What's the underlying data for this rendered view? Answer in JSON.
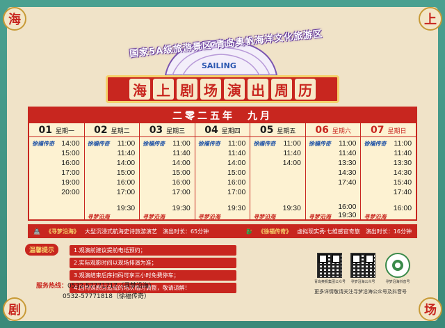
{
  "corners": [
    "海",
    "上",
    "剧",
    "场"
  ],
  "header": {
    "subtitle": "国家5A级旅游景区·青岛奥帆海洋文化旅游区",
    "building_sign": "SAILING",
    "title_chars": [
      "海",
      "上",
      "剧",
      "场",
      "演",
      "出",
      "周",
      "历"
    ]
  },
  "schedule": {
    "month": "二零二五年　九月",
    "days": [
      {
        "num": "01",
        "week": "星期一",
        "weekend": false,
        "slots": [
          {
            "row": 0,
            "logo": "",
            "time": "14:00"
          },
          {
            "row": 1,
            "logo": "",
            "time": "15:00"
          },
          {
            "row": 2,
            "logo": "",
            "time": "16:00"
          },
          {
            "row": 3,
            "logo": "",
            "time": "17:00"
          },
          {
            "row": 4,
            "logo": "",
            "time": "19:00"
          },
          {
            "row": 5,
            "logo": "",
            "time": "20:00"
          }
        ],
        "logo_rows": [
          {
            "row": 0,
            "text": "徐福传奇",
            "red": false
          }
        ]
      },
      {
        "num": "02",
        "week": "星期二",
        "weekend": false,
        "slots": [
          {
            "row": 0,
            "time": "11:00"
          },
          {
            "row": 1,
            "time": "11:40"
          },
          {
            "row": 2,
            "time": "14:00"
          },
          {
            "row": 3,
            "time": "15:00"
          },
          {
            "row": 4,
            "time": "16:00"
          },
          {
            "row": 5,
            "time": "17:00"
          },
          {
            "row": 7,
            "time": "19:30"
          }
        ],
        "logo_rows": [
          {
            "row": 0,
            "text": "徐福传奇",
            "red": false
          },
          {
            "row": 7,
            "text": "寻梦沿海",
            "red": true
          }
        ]
      },
      {
        "num": "03",
        "week": "星期三",
        "weekend": false,
        "slots": [
          {
            "row": 0,
            "time": "11:00"
          },
          {
            "row": 1,
            "time": "11:40"
          },
          {
            "row": 2,
            "time": "14:00"
          },
          {
            "row": 3,
            "time": "15:00"
          },
          {
            "row": 4,
            "time": "16:00"
          },
          {
            "row": 5,
            "time": "17:00"
          },
          {
            "row": 7,
            "time": "19:30"
          }
        ],
        "logo_rows": [
          {
            "row": 0,
            "text": "徐福传奇",
            "red": false
          },
          {
            "row": 7,
            "text": "寻梦沿海",
            "red": true
          }
        ]
      },
      {
        "num": "04",
        "week": "星期四",
        "weekend": false,
        "slots": [
          {
            "row": 0,
            "time": "11:00"
          },
          {
            "row": 1,
            "time": "11:40"
          },
          {
            "row": 2,
            "time": "14:00"
          },
          {
            "row": 3,
            "time": "15:00"
          },
          {
            "row": 4,
            "time": "16:00"
          },
          {
            "row": 5,
            "time": "17:00"
          },
          {
            "row": 7,
            "time": "19:30"
          }
        ],
        "logo_rows": [
          {
            "row": 0,
            "text": "徐福传奇",
            "red": false
          },
          {
            "row": 7,
            "text": "寻梦沿海",
            "red": true
          }
        ]
      },
      {
        "num": "05",
        "week": "星期五",
        "weekend": false,
        "slots": [
          {
            "row": 0,
            "time": "11:00"
          },
          {
            "row": 1,
            "time": "11:40"
          },
          {
            "row": 2,
            "time": "14:00"
          },
          {
            "row": 7,
            "time": "19:30"
          }
        ],
        "logo_rows": [
          {
            "row": 0,
            "text": "徐福传奇",
            "red": false
          },
          {
            "row": 7,
            "text": "寻梦沿海",
            "red": true
          }
        ]
      },
      {
        "num": "06",
        "week": "星期六",
        "weekend": true,
        "slots": [
          {
            "row": 0,
            "time": "11:00"
          },
          {
            "row": 1,
            "time": "11:40"
          },
          {
            "row": 2,
            "time": "13:30"
          },
          {
            "row": 3,
            "time": "14:30"
          },
          {
            "row": 4,
            "time": "17:40"
          },
          {
            "row": 7,
            "time": "16:00"
          },
          {
            "row": 8,
            "time": "19:30"
          }
        ],
        "logo_rows": [
          {
            "row": 0,
            "text": "徐福传奇",
            "red": false
          },
          {
            "row": 7,
            "text": "寻梦沿海",
            "red": true
          }
        ]
      },
      {
        "num": "07",
        "week": "星期日",
        "weekend": true,
        "slots": [
          {
            "row": 0,
            "time": "11:00"
          },
          {
            "row": 1,
            "time": "11:40"
          },
          {
            "row": 2,
            "time": "13:30"
          },
          {
            "row": 3,
            "time": "14:30"
          },
          {
            "row": 4,
            "time": "15:40"
          },
          {
            "row": 5,
            "time": "17:40"
          },
          {
            "row": 7,
            "time": "16:00"
          }
        ],
        "logo_rows": [
          {
            "row": 0,
            "text": "徐福传奇",
            "red": false
          },
          {
            "row": 7,
            "text": "寻梦沿海",
            "red": true
          }
        ]
      }
    ]
  },
  "shows": {
    "show1_name": "《寻梦沿海》",
    "show1_desc": "大型沉浸式航海史诗旅游演艺",
    "show1_duration": "演出时长：65分钟",
    "show2_name": "《徐福传奇》",
    "show2_desc": "虚拟现实秀·七维感官奇旅",
    "show2_duration": "演出时长：16分钟"
  },
  "tips": {
    "label": "温馨提示",
    "items": [
      "1.观演前建议提前电话预约；",
      "2.实际观影时间以现场排演为准；",
      "3.观演结束后序扫码可享三小时免费停车；",
      "4.因特殊原因造成的场次临时调整，敬请谅解！"
    ]
  },
  "hotline": {
    "label": "服务热线：",
    "line1": "0532-57771717（寻梦沿海）",
    "line2": "0532-57771818（徐福传奇）"
  },
  "qrcodes": [
    {
      "caption": "青岛奥帆集团公众号"
    },
    {
      "caption": "寻梦沿海公众号"
    },
    {
      "caption": "寻梦沿海抖音号"
    }
  ],
  "footer_note": "更多详情敬请关注寻梦沿海公众号及抖音号",
  "colors": {
    "red": "#c8261f",
    "teal": "#3f8f7f",
    "cream": "#f0e3c8",
    "gold": "#f5d06a"
  }
}
